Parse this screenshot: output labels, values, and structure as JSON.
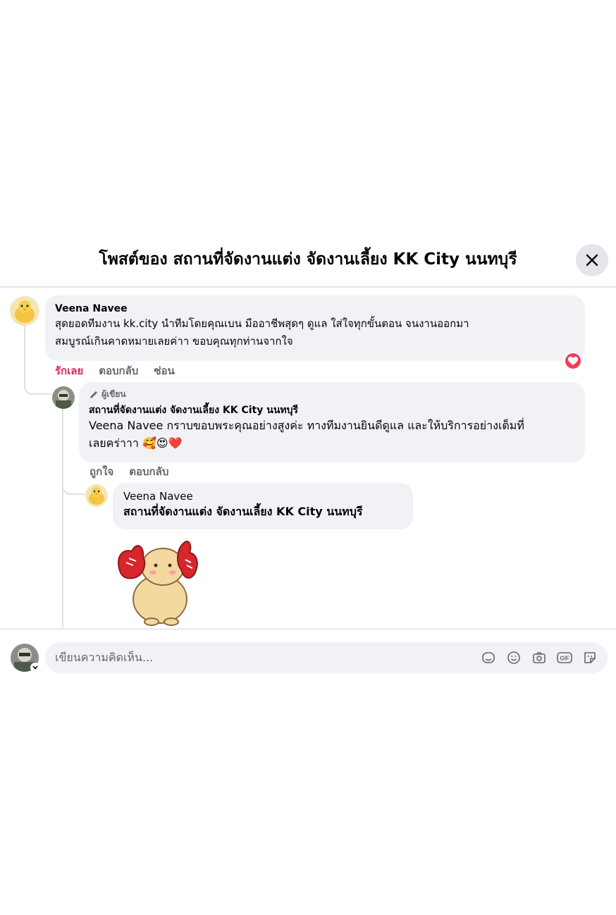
{
  "header": {
    "title": "โพสต์ของ สถานที่จัดงานแต่ง จัดงานเลี้ยง KK City นนทบุรี"
  },
  "comments": [
    {
      "author": "Veena Navee",
      "text_line1": "สุดยอดทีมงาน kk.city นำทีมโดยคุณเบน มืออาชีพสุดๆ ดูแล ใส่ใจทุกขั้นตอน จนงานออกมา",
      "text_line2": "สมบูรณ์เกินคาดหมายเลยค่าา ขอบคุณทุกท่านจากใจ",
      "actions": [
        "รักเลย",
        "ตอบกลับ",
        "ซ่อน"
      ],
      "reaction": "heart-icon"
    },
    {
      "author_tag": "ผู้เขียน",
      "author": "สถานที่จัดงานแต่ง จัดงานเลี้ยง KK City นนทบุรี",
      "mention": "Veena Navee",
      "text_line1": " กราบขอบพระคุณอย่างสูงค่ะ ทางทีมงานยินดีดูแล และให้บริการอย่างเต็มที่",
      "text_line2": "เลยคร่าาา 🥰😍❤️",
      "actions": [
        "ถูกใจ",
        "ตอบกลับ"
      ]
    },
    {
      "author": "Veena Navee",
      "mention": "สถานที่จัดงานแต่ง จัดงานเลี้ยง KK City นนทบุรี",
      "sticker": "cheering-character-sticker"
    }
  ],
  "composer": {
    "placeholder": "เขียนความคิดเห็น...",
    "icons": [
      "avatar-sticker-icon",
      "emoji-icon",
      "camera-icon",
      "gif-icon",
      "sticker-icon"
    ],
    "gif_label": "GIF"
  },
  "colors": {
    "bubble": "#f0f2f5",
    "love": "#e0245e",
    "heart_badge": "#f33e58",
    "secondary_text": "#65676b"
  }
}
